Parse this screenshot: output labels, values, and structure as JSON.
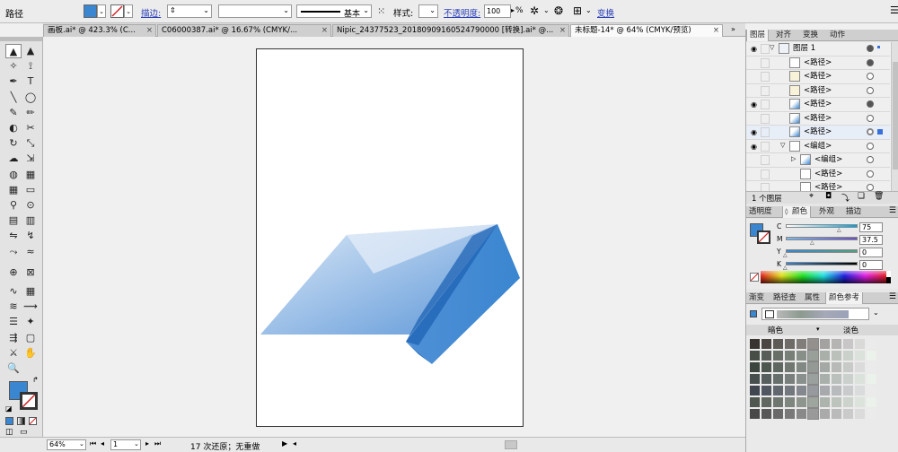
{
  "control_bar": {
    "object_label": "路径",
    "fill_color": "#3a86d0",
    "stroke_label": "描边:",
    "stroke_style": "基本",
    "style_label": "样式:",
    "opacity_label": "不透明度:",
    "opacity_value": "100",
    "opacity_unit": "%",
    "transform_link": "变换"
  },
  "tabs": [
    {
      "label": "画板.ai* @ 423.3% (C..."
    },
    {
      "label": "C06000387.ai* @ 16.67% (CMYK/..."
    },
    {
      "label": "Nipic_24377523_20180909160524790000 [转换].ai* @..."
    },
    {
      "label": "未标题-14* @ 64% (CMYK/预览)"
    }
  ],
  "tab_close": "×",
  "tools": [
    {
      "glyph": "▲",
      "name": "selection-tool-icon"
    },
    {
      "glyph": "▲",
      "name": "direct-selection-tool-icon"
    },
    {
      "glyph": "✧",
      "name": "magic-wand-tool-icon"
    },
    {
      "glyph": "⟟",
      "name": "lasso-tool-icon"
    },
    {
      "glyph": "✒",
      "name": "pen-tool-icon"
    },
    {
      "glyph": "T",
      "name": "type-tool-icon"
    },
    {
      "glyph": "╲",
      "name": "line-tool-icon"
    },
    {
      "glyph": "◯",
      "name": "ellipse-tool-icon"
    },
    {
      "glyph": "✎",
      "name": "paintbrush-tool-icon"
    },
    {
      "glyph": "✏",
      "name": "pencil-tool-icon"
    },
    {
      "glyph": "◐",
      "name": "blob-brush-tool-icon"
    },
    {
      "glyph": "✂",
      "name": "scissors-tool-icon"
    },
    {
      "glyph": "↻",
      "name": "rotate-tool-icon"
    },
    {
      "glyph": "⤡",
      "name": "scale-tool-icon"
    },
    {
      "glyph": "☁",
      "name": "warp-tool-icon"
    },
    {
      "glyph": "⇲",
      "name": "free-transform-tool-icon"
    },
    {
      "glyph": "◍",
      "name": "shape-builder-tool-icon"
    },
    {
      "glyph": "▦",
      "name": "perspective-grid-tool-icon"
    },
    {
      "glyph": "▦",
      "name": "mesh-tool-icon"
    },
    {
      "glyph": "▭",
      "name": "gradient-tool-icon"
    },
    {
      "glyph": "⚲",
      "name": "eyedropper-tool-icon"
    },
    {
      "glyph": "⊙",
      "name": "blend-tool-icon"
    },
    {
      "glyph": "▤",
      "name": "symbol-sprayer-tool-icon"
    },
    {
      "glyph": "▥",
      "name": "column-graph-tool-icon"
    },
    {
      "glyph": "⇋",
      "name": "width-tool-icon"
    },
    {
      "glyph": "↯",
      "name": "artboard-tool-icon"
    },
    {
      "glyph": "⤳",
      "name": "slice-tool-icon"
    },
    {
      "glyph": "≈",
      "name": "eraser-tool-icon"
    },
    {
      "glyph": "⊕",
      "name": "crosshair-tool-icon"
    },
    {
      "glyph": "⊠",
      "name": "warp-shape-tool-icon"
    },
    {
      "glyph": "∿",
      "name": "wave-tool-icon"
    },
    {
      "glyph": "▦",
      "name": "chart-tool-icon"
    },
    {
      "glyph": "≋",
      "name": "twirl-tool-icon"
    },
    {
      "glyph": "⟿",
      "name": "path-tool-icon"
    },
    {
      "glyph": "☰",
      "name": "list-tool-icon"
    },
    {
      "glyph": "✦",
      "name": "pucker-tool-icon"
    },
    {
      "glyph": "⇶",
      "name": "bloat-tool-icon"
    },
    {
      "glyph": "▢",
      "name": "rectangle-slice-tool-icon"
    },
    {
      "glyph": "⚔",
      "name": "knife-tool-icon"
    },
    {
      "glyph": "✋",
      "name": "hand-tool-icon"
    },
    {
      "glyph": "🔍",
      "name": "zoom-tool-icon"
    }
  ],
  "artwork": {
    "light": "#dce9f7",
    "mid": "#7eaee0",
    "dark": "#3a86d0",
    "deep": "#1d63b4"
  },
  "status": {
    "zoom": "64%",
    "page": "1",
    "history": "17 次还原；无重做"
  },
  "layers_panel": {
    "tabs": [
      "图层",
      "对齐",
      "变换",
      "动作"
    ],
    "rows": [
      {
        "label": "图层 1",
        "eye": "◉",
        "level": 0,
        "target": "f"
      },
      {
        "label": "<路径>",
        "eye": "",
        "level": 1,
        "target": "f"
      },
      {
        "label": "<路径>",
        "eye": "",
        "level": 1,
        "target": ""
      },
      {
        "label": "<路径>",
        "eye": "",
        "level": 1,
        "target": ""
      },
      {
        "label": "<路径>",
        "eye": "◉",
        "level": 1,
        "target": "f"
      },
      {
        "label": "<路径>",
        "eye": "",
        "level": 1,
        "target": ""
      },
      {
        "label": "<路径>",
        "eye": "◉",
        "level": 1,
        "target": "s"
      },
      {
        "label": "<编组>",
        "eye": "◉",
        "level": 1,
        "target": ""
      },
      {
        "label": "<编组>",
        "eye": "",
        "level": 2,
        "target": ""
      },
      {
        "label": "<路径>",
        "eye": "",
        "level": 2,
        "target": ""
      },
      {
        "label": "<路径>",
        "eye": "",
        "level": 2,
        "target": ""
      }
    ],
    "footer": "1 个图层"
  },
  "color_panel": {
    "tabs": [
      "透明度",
      "颜色",
      "外观",
      "描边"
    ],
    "channels": [
      {
        "label": "C",
        "value": "75",
        "fill": 0.75
      },
      {
        "label": "M",
        "value": "37.5",
        "fill": 0.375
      },
      {
        "label": "Y",
        "value": "0",
        "fill": 0
      },
      {
        "label": "K",
        "value": "0",
        "fill": 0
      }
    ]
  },
  "swatch_panel": {
    "tabs": [
      "渐变",
      "路径查",
      "属性",
      "颜色参考"
    ],
    "dark_label": "暗色",
    "light_label": "淡色"
  }
}
